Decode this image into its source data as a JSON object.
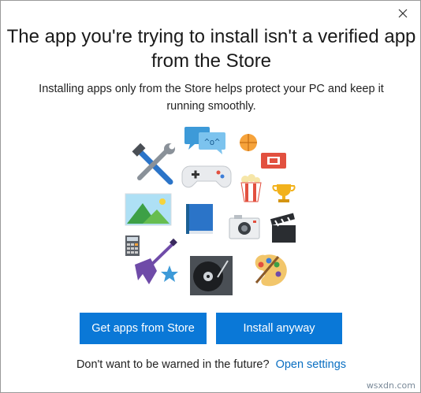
{
  "dialog": {
    "title": "The app you're trying to install isn't a verified app from the Store",
    "message": "Installing apps only from the Store helps protect your PC and keep it running smoothly.",
    "buttons": {
      "store_label": "Get apps from Store",
      "install_label": "Install anyway"
    },
    "footer": {
      "prompt": "Don't want to be warned in the future?",
      "link_label": "Open settings"
    },
    "chat_bubble_text": "^o^",
    "close_icon": "close-icon",
    "accent_color": "#0a78d7",
    "link_color": "#0a6fc2"
  },
  "watermark": "wsxdn.com"
}
